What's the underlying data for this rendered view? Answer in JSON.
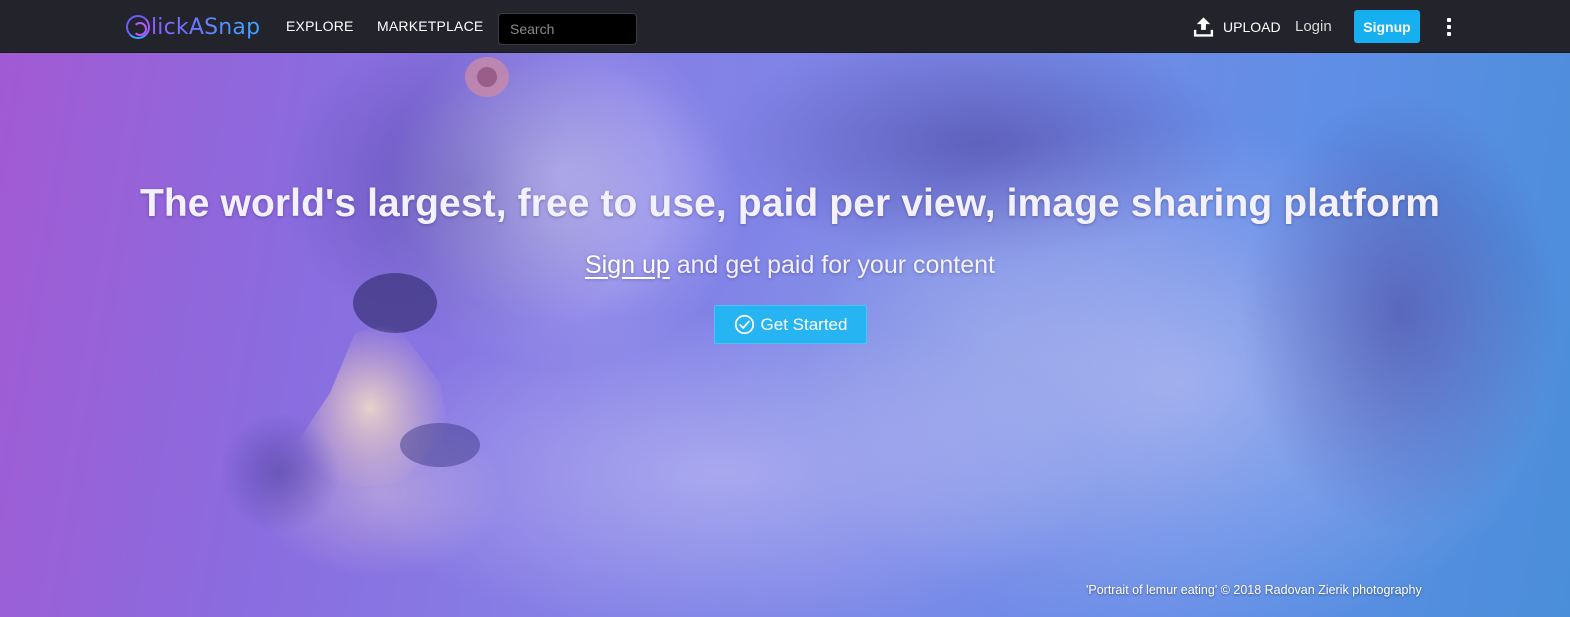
{
  "nav": {
    "logo_text": "lickASnap",
    "links": {
      "explore": "EXPLORE",
      "marketplace": "MARKETPLACE"
    },
    "search_placeholder": "Search",
    "upload_label": "UPLOAD",
    "login_label": "Login",
    "signup_label": "Signup"
  },
  "hero": {
    "headline": "The world's largest, free to use, paid per view, image sharing platform",
    "signup_link": "Sign up",
    "subline_rest": " and get paid for your content",
    "cta_label": "Get Started",
    "photo_credit": "'Portrait of lemur eating' © 2018 Radovan Zierik photography"
  },
  "colors": {
    "navbar_bg": "#23242b",
    "accent": "#16b0f0",
    "hero_gradient_start": "#a25ad3",
    "hero_gradient_end": "#4a8ed9"
  },
  "icons": [
    "clickasnap-logo-icon",
    "upload-icon",
    "more-vertical-icon",
    "check-circle-icon"
  ]
}
